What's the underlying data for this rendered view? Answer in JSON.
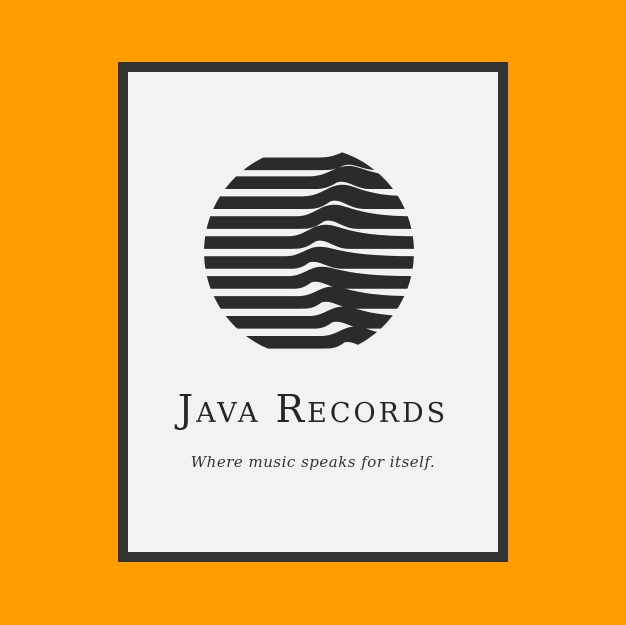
{
  "brand": {
    "name": "Java Records",
    "tagline": "Where music speaks for itself."
  },
  "icons": {
    "logo": "striped-circle-wave-logo-icon"
  },
  "colors": {
    "background": "#FF9D00",
    "card": "#F2F2F2",
    "frame": "#333333",
    "ink": "#262626"
  }
}
